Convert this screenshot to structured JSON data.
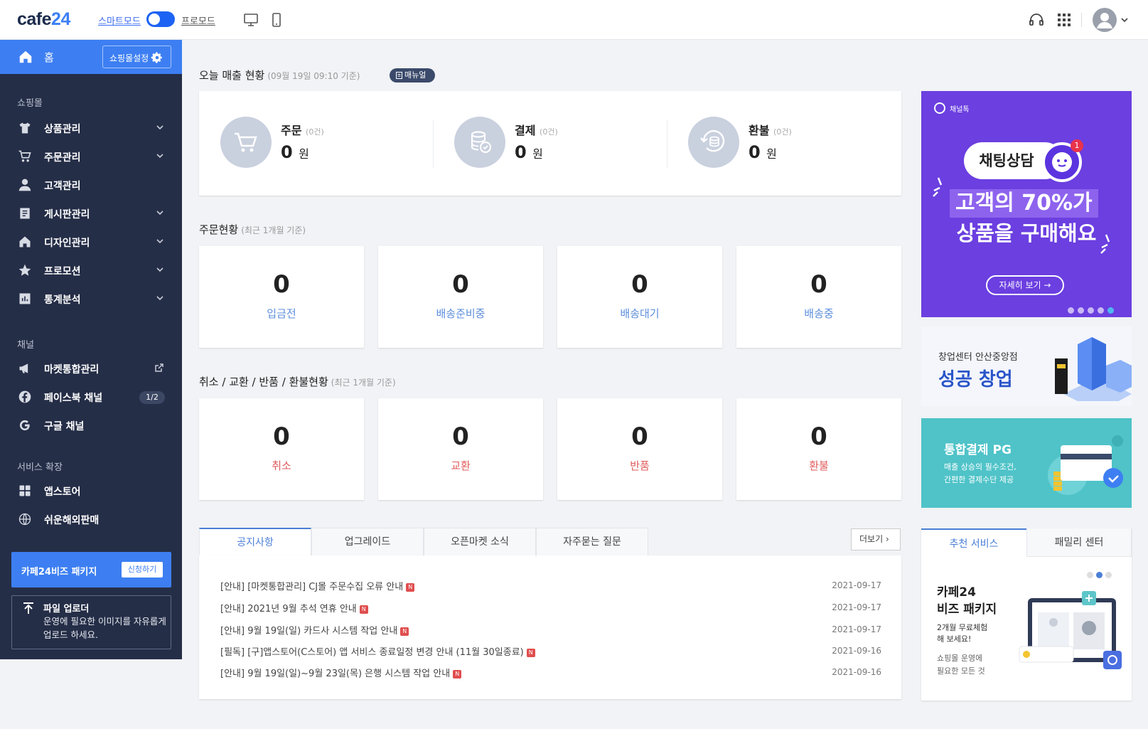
{
  "topbar": {
    "logo_a": "cafe",
    "logo_b": "24",
    "smart_mode": "스마트모드",
    "pro_mode": "프로모드"
  },
  "sidebar": {
    "home": "홈",
    "shop_settings": "쇼핑몰설정",
    "sec_shop": "쇼핑몰",
    "sec_channel": "채널",
    "sec_service": "서비스 확장",
    "items": [
      {
        "label": "상품관리"
      },
      {
        "label": "주문관리"
      },
      {
        "label": "고객관리"
      },
      {
        "label": "게시판관리"
      },
      {
        "label": "디자인관리"
      },
      {
        "label": "프로모션"
      },
      {
        "label": "통계분석"
      }
    ],
    "channels": [
      {
        "label": "마켓통합관리"
      },
      {
        "label": "페이스북 채널",
        "badge": "1/2"
      },
      {
        "label": "구글 채널"
      }
    ],
    "services": [
      {
        "label": "앱스토어"
      },
      {
        "label": "쉬운해외판매"
      }
    ],
    "biz": {
      "label": "카페24비즈 패키지",
      "apply": "신청하기"
    },
    "uploader": {
      "title": "파일 업로더",
      "desc": "운영에 필요한 이미지를 자유롭게 업로드 하세요."
    }
  },
  "sales": {
    "title": "오늘 매출 현황",
    "sub": "(09월 19일 09:10 기준)",
    "manual": "매뉴얼",
    "cells": [
      {
        "name": "주문",
        "count": "(0건)",
        "amount": "0",
        "unit": "원"
      },
      {
        "name": "결제",
        "count": "(0건)",
        "amount": "0",
        "unit": "원"
      },
      {
        "name": "환불",
        "count": "(0건)",
        "amount": "0",
        "unit": "원"
      }
    ]
  },
  "orders": {
    "title": "주문현황",
    "sub": "(최근 1개월 기준)",
    "boxes": [
      {
        "num": "0",
        "label": "입금전"
      },
      {
        "num": "0",
        "label": "배송준비중"
      },
      {
        "num": "0",
        "label": "배송대기"
      },
      {
        "num": "0",
        "label": "배송중"
      }
    ]
  },
  "claims": {
    "title": "취소 / 교환 / 반품 / 환불현황",
    "sub": "(최근 1개월 기준)",
    "boxes": [
      {
        "num": "0",
        "label": "취소"
      },
      {
        "num": "0",
        "label": "교환"
      },
      {
        "num": "0",
        "label": "반품"
      },
      {
        "num": "0",
        "label": "환불"
      }
    ]
  },
  "notices": {
    "tabs": [
      "공지사항",
      "업그레이드",
      "오픈마켓 소식",
      "자주묻는 질문"
    ],
    "more": "더보기",
    "rows": [
      {
        "title": "[안내] [마켓통합관리] CJ몰 주문수집 오류 안내",
        "date": "2021-09-17"
      },
      {
        "title": "[안내] 2021년 9월 추석 연휴 안내",
        "date": "2021-09-17"
      },
      {
        "title": "[안내] 9월 19일(일) 카드사 시스템 작업 안내",
        "date": "2021-09-17"
      },
      {
        "title": "[필독] [구]앱스토어(C스토어) 앱 서비스 종료일정 변경 안내 (11월 30일종료)",
        "date": "2021-09-16"
      },
      {
        "title": "[안내] 9월 19일(일)~9월 23일(목) 은행 시스템 작업 안내",
        "date": "2021-09-16"
      }
    ],
    "new_badge": "N"
  },
  "ads": {
    "ad1": {
      "brand": "채널톡",
      "bubble": "채팅상담",
      "line1": "고객의 70%가",
      "line2": "상품을 구매해요",
      "btn": "자세히 보기",
      "notif": "1"
    },
    "ad2": {
      "line1": "창업센터 안산중앙점",
      "line2": "성공 창업"
    },
    "ad3": {
      "title": "통합결제 PG",
      "line1": "매출 상승의 필수조건,",
      "line2": "간편한 결제수단 제공"
    }
  },
  "recommend": {
    "tabs": [
      "추천 서비스",
      "패밀리 센터"
    ],
    "title1": "카페24",
    "title2": "비즈 패키지",
    "desc1": "2개월 무료체험",
    "desc2": "해 보세요!",
    "sub1": "쇼핑몰 운영에",
    "sub2": "필요한 모든 것"
  },
  "colors": {
    "accent": "#3d7ff2",
    "sidebar": "#252e47",
    "purple": "#6b3fe0",
    "teal": "#4fc3c8"
  }
}
